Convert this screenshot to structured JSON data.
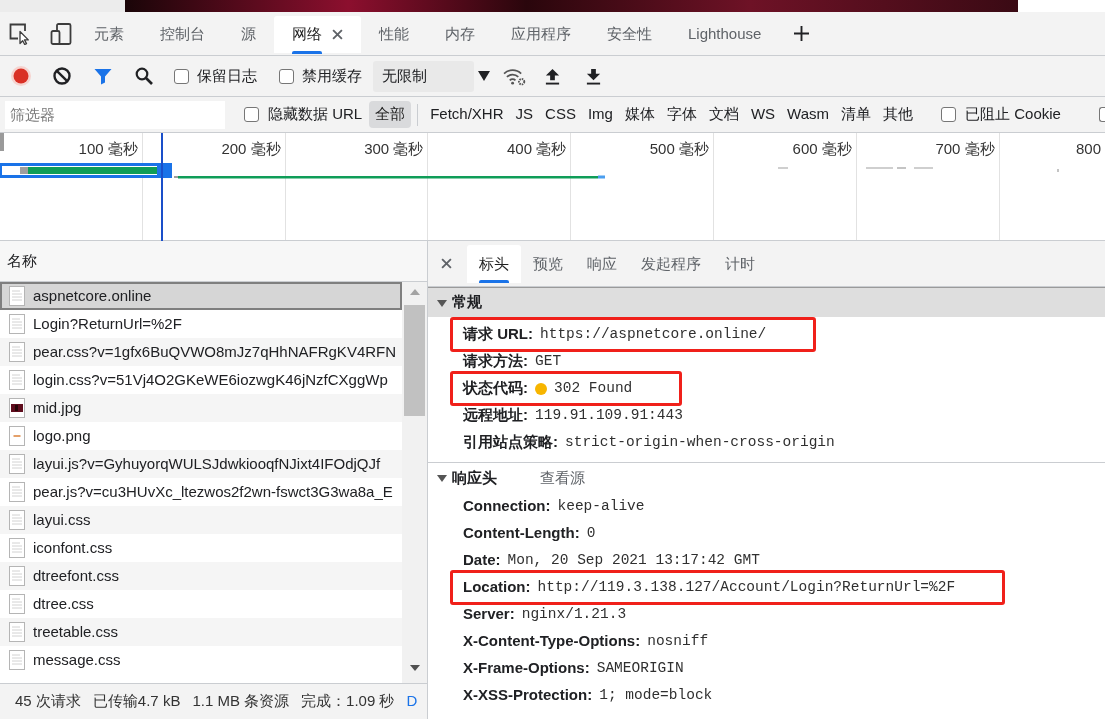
{
  "devtools_tabs": [
    {
      "label": "元素",
      "selected": false
    },
    {
      "label": "控制台",
      "selected": false
    },
    {
      "label": "源",
      "selected": false
    },
    {
      "label": "网络",
      "selected": true
    },
    {
      "label": "性能",
      "selected": false
    },
    {
      "label": "内存",
      "selected": false
    },
    {
      "label": "应用程序",
      "selected": false
    },
    {
      "label": "安全性",
      "selected": false
    },
    {
      "label": "Lighthouse",
      "selected": false
    }
  ],
  "toolbar": {
    "recording": true,
    "options": [
      {
        "label": "保留日志",
        "checked": false
      },
      {
        "label": "禁用缓存",
        "checked": false
      }
    ],
    "throttling": "无限制"
  },
  "filter_bar": {
    "placeholder": "筛选器",
    "hide_data_urls": {
      "label": "隐藏数据 URL",
      "checked": false
    },
    "types": [
      {
        "label": "全部",
        "selected": true
      },
      {
        "label": "Fetch/XHR",
        "selected": false
      },
      {
        "label": "JS",
        "selected": false
      },
      {
        "label": "CSS",
        "selected": false
      },
      {
        "label": "Img",
        "selected": false
      },
      {
        "label": "媒体",
        "selected": false
      },
      {
        "label": "字体",
        "selected": false
      },
      {
        "label": "文档",
        "selected": false
      },
      {
        "label": "WS",
        "selected": false
      },
      {
        "label": "Wasm",
        "selected": false
      },
      {
        "label": "清单",
        "selected": false
      },
      {
        "label": "其他",
        "selected": false
      }
    ],
    "blocked_cookies": {
      "label": "已阻止 Cookie",
      "checked": false
    },
    "more_checkbox": {
      "checked": false
    }
  },
  "timeline": {
    "ticks": [
      "100 毫秒",
      "200 毫秒",
      "300 毫秒",
      "400 毫秒",
      "500 毫秒",
      "600 毫秒",
      "700 毫秒",
      "800"
    ]
  },
  "requests": {
    "column": "名称",
    "rows": [
      {
        "name": "aspnetcore.online",
        "kind": "document",
        "selected": true
      },
      {
        "name": "Login?ReturnUrl=%2F",
        "kind": "document",
        "selected": false
      },
      {
        "name": "pear.css?v=1gfx6BuQVWO8mJz7qHhNAFRgKV4RFN",
        "kind": "document",
        "selected": false
      },
      {
        "name": "login.css?v=51Vj4O2GKeWE6iozwgK46jNzfCXggWp",
        "kind": "document",
        "selected": false
      },
      {
        "name": "mid.jpg",
        "kind": "photo",
        "selected": false
      },
      {
        "name": "logo.png",
        "kind": "image",
        "selected": false
      },
      {
        "name": "layui.js?v=GyhuyorqWULSJdwkiooqfNJixt4IFOdjQJf",
        "kind": "document",
        "selected": false
      },
      {
        "name": "pear.js?v=cu3HUvXc_ltezwos2f2wn-fswct3G3wa8a_E",
        "kind": "document",
        "selected": false
      },
      {
        "name": "layui.css",
        "kind": "document",
        "selected": false
      },
      {
        "name": "iconfont.css",
        "kind": "document",
        "selected": false
      },
      {
        "name": "dtreefont.css",
        "kind": "document",
        "selected": false
      },
      {
        "name": "dtree.css",
        "kind": "document",
        "selected": false
      },
      {
        "name": "treetable.css",
        "kind": "document",
        "selected": false
      },
      {
        "name": "message.css",
        "kind": "document",
        "selected": false
      }
    ]
  },
  "status_bar": [
    {
      "text": "45 次请求"
    },
    {
      "text": "已传输4.7 kB"
    },
    {
      "text": "1.1 MB 条资源"
    },
    {
      "text": "完成：1.09 秒"
    },
    {
      "text": "D",
      "color": "#1a73e8"
    }
  ],
  "details": {
    "tabs": [
      {
        "label": "标头",
        "selected": true
      },
      {
        "label": "预览",
        "selected": false
      },
      {
        "label": "响应",
        "selected": false
      },
      {
        "label": "发起程序",
        "selected": false
      },
      {
        "label": "计时",
        "selected": false
      }
    ],
    "sections": [
      {
        "title": "常规",
        "expanded": true,
        "selected": true,
        "rows": [
          {
            "name": "请求 URL:",
            "value": "https://aspnetcore.online/",
            "highlighted": true
          },
          {
            "name": "请求方法:",
            "value": "GET",
            "highlighted": false
          },
          {
            "name": "状态代码:",
            "value": "302 Found",
            "color": "#f7b500",
            "highlighted": true
          },
          {
            "name": "远程地址:",
            "value": "119.91.109.91:443",
            "highlighted": false
          },
          {
            "name": "引用站点策略:",
            "value": "strict-origin-when-cross-origin",
            "highlighted": false
          }
        ]
      },
      {
        "title": "响应头",
        "expanded": true,
        "selected": false,
        "link": "查看源",
        "rows": [
          {
            "name": "Connection:",
            "value": "keep-alive",
            "highlighted": false
          },
          {
            "name": "Content-Length:",
            "value": "0",
            "highlighted": false
          },
          {
            "name": "Date:",
            "value": "Mon, 20 Sep 2021 13:17:42 GMT",
            "highlighted": false
          },
          {
            "name": "Location:",
            "value": "http://119.3.138.127/Account/Login?ReturnUrl=%2F",
            "highlighted": true
          },
          {
            "name": "Server:",
            "value": "nginx/1.21.3",
            "highlighted": false
          },
          {
            "name": "X-Content-Type-Options:",
            "value": "nosniff",
            "highlighted": false
          },
          {
            "name": "X-Frame-Options:",
            "value": "SAMEORIGIN",
            "highlighted": false
          },
          {
            "name": "X-XSS-Protection:",
            "value": "1; mode=block",
            "highlighted": false
          }
        ]
      }
    ]
  }
}
